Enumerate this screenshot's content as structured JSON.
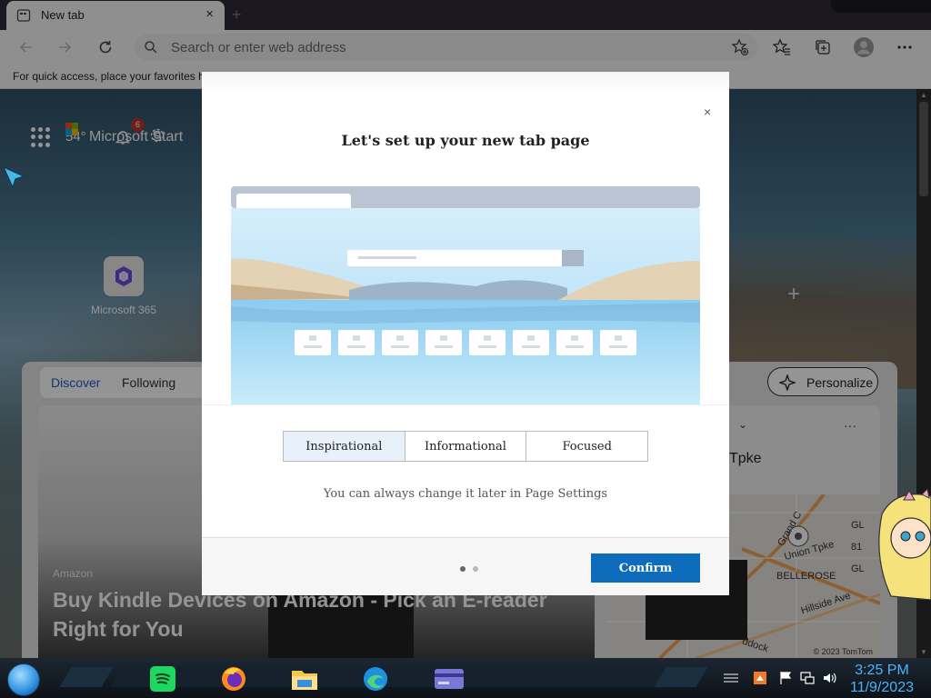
{
  "browser": {
    "tab_title": "New tab",
    "tab_close": "×",
    "new_tab": "+",
    "address_placeholder": "Search or enter web address",
    "favorites_bar_text": "For quick access, place your favorites h"
  },
  "newtab": {
    "weather": "54°",
    "brand": "Microsoft Start",
    "notification_count": "6",
    "quicklink_label": "Microsoft 365",
    "quicklink_add": "+",
    "feed_tabs": [
      "Discover",
      "Following"
    ],
    "personalize_label": "Personalize",
    "main_card": {
      "source": "Amazon",
      "title": "Buy Kindle Devices on Amazon - Pick an E-reader Right for You"
    },
    "side_card": {
      "title": "Tpke",
      "more": "···",
      "chevron": "⌄",
      "map_labels": [
        "Grand C",
        "Union Tpke",
        "BELLEROSE",
        "Hillside Ave",
        "GL",
        "81",
        "GL",
        "ddock"
      ],
      "map_copyright": "© 2023 TomTom"
    }
  },
  "modal": {
    "close": "×",
    "title": "Let's set up your new tab page",
    "options": [
      "Inspirational",
      "Informational",
      "Focused"
    ],
    "selected_index": 0,
    "hint": "You can always change it later in Page Settings",
    "page_dots": 2,
    "current_page": 1,
    "confirm_label": "Confirm",
    "accent_color": "#0f6cbd"
  },
  "taskbar": {
    "time": "3:25 PM",
    "date": "11/9/2023",
    "apps": [
      "spotify-icon",
      "firefox-icon",
      "file-explorer-icon",
      "edge-icon",
      "card-app-icon"
    ]
  }
}
